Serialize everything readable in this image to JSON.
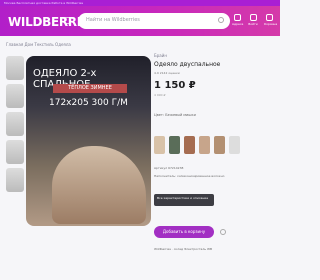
{
  "topbar": {
    "text": "Москва  Бесплатная доставка  Работа в Wildberries"
  },
  "header": {
    "logo": "WILDBERRIES",
    "search_placeholder": "Найти на Wildberries",
    "icons": [
      "Адреса",
      "Войти",
      "Корзина"
    ]
  },
  "breadcrumb": "Главная  Дом  Текстиль  Одеяла",
  "product": {
    "photo_title": "ОДЕЯЛО 2-х СПАЛЬНОЕ",
    "photo_badge": "ТЁПЛОЕ  ЗИМНЕЕ",
    "photo_size": "172х205  300 Г/М",
    "brand": "Брайн",
    "name": "Одеяло двуспальное",
    "rating": "4.9  2142 оценки",
    "price": "1 150 ₽",
    "old_price": "4 990 ₽",
    "color_label": "Цвет: Бежевый мишки",
    "spec1": "Артикул 67214238",
    "spec2": "Наполнитель: силиконизированное волокно",
    "tooltip": "Все характеристики и описание",
    "button": "Добавить в корзину",
    "shipping": "Wildberries · склад Электросталь WB"
  }
}
